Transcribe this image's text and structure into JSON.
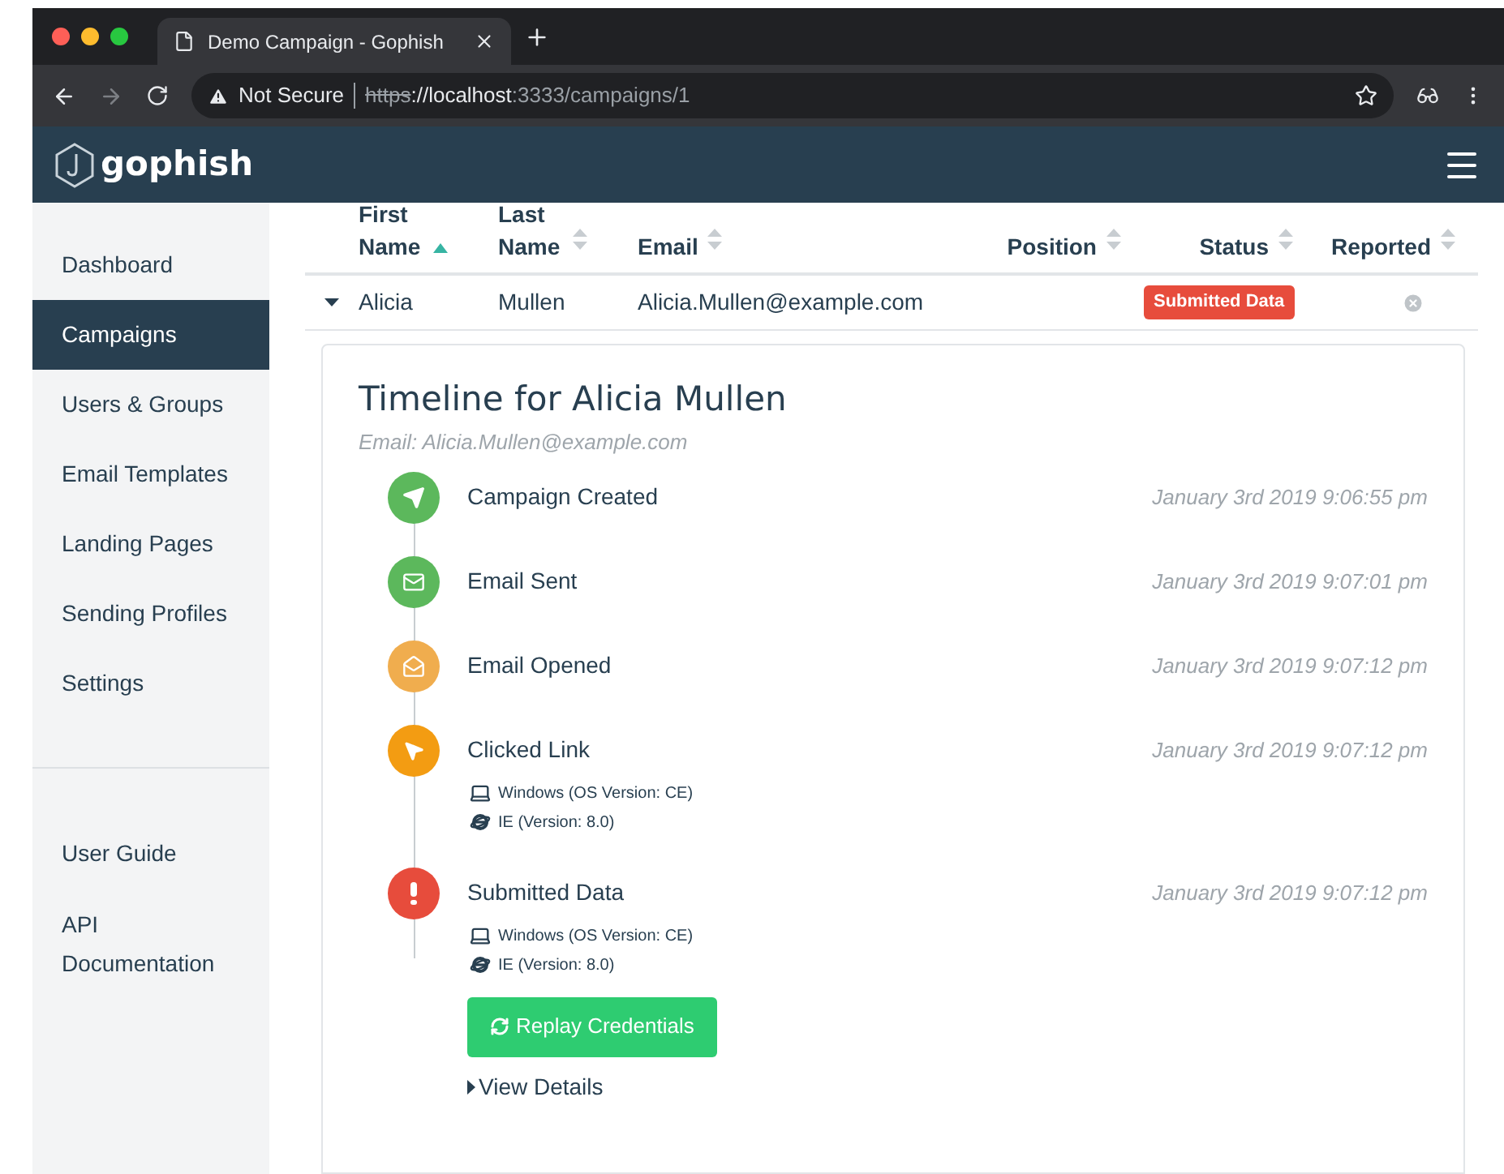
{
  "browser": {
    "tab_title": "Demo Campaign - Gophish",
    "security": "Not Secure",
    "url_scheme": "https",
    "url_host": "://localhost",
    "url_path": ":3333/campaigns/1"
  },
  "app": {
    "logo_text": "gophish"
  },
  "sidebar": {
    "items": [
      {
        "label": "Dashboard",
        "selected": false
      },
      {
        "label": "Campaigns",
        "selected": true
      },
      {
        "label": "Users & Groups",
        "selected": false
      },
      {
        "label": "Email Templates",
        "selected": false
      },
      {
        "label": "Landing Pages",
        "selected": false
      },
      {
        "label": "Sending Profiles",
        "selected": false
      },
      {
        "label": "Settings",
        "selected": false
      }
    ],
    "links": [
      "User Guide",
      "API Documentation"
    ]
  },
  "table": {
    "columns": [
      {
        "label": "First Name",
        "sorted": true
      },
      {
        "label": "Last Name",
        "sorted": false
      },
      {
        "label": "Email",
        "sorted": false
      },
      {
        "label": "Position",
        "sorted": false
      },
      {
        "label": "Status",
        "sorted": false
      },
      {
        "label": "Reported",
        "sorted": false
      }
    ],
    "rows": [
      {
        "expanded": true,
        "first_name": "Alicia",
        "last_name": "Mullen",
        "email": "Alicia.Mullen@example.com",
        "status": "Submitted Data",
        "reported": false
      }
    ]
  },
  "timeline": {
    "title": "Timeline for Alicia Mullen",
    "subtitle": "Email: Alicia.Mullen@example.com",
    "events": [
      {
        "kind": "created",
        "color": "#5cb85c",
        "label": "Campaign Created",
        "time": "January 3rd 2019 9:06:55 pm"
      },
      {
        "kind": "sent",
        "color": "#5cb85c",
        "label": "Email Sent",
        "time": "January 3rd 2019 9:07:01 pm"
      },
      {
        "kind": "opened",
        "color": "#f0ad4e",
        "label": "Email Opened",
        "time": "January 3rd 2019 9:07:12 pm"
      },
      {
        "kind": "clicked",
        "color": "#f39c12",
        "label": "Clicked Link",
        "time": "January 3rd 2019 9:07:12 pm",
        "details": [
          {
            "kind": "os",
            "text": "Windows (OS Version: CE)"
          },
          {
            "kind": "browser",
            "text": "IE (Version: 8.0)"
          }
        ]
      },
      {
        "kind": "submitted",
        "color": "#e74c3c",
        "label": "Submitted Data",
        "time": "January 3rd 2019 9:07:12 pm",
        "details": [
          {
            "kind": "os",
            "text": "Windows (OS Version: CE)"
          },
          {
            "kind": "browser",
            "text": "IE (Version: 8.0)"
          }
        ],
        "action": "Replay Credentials",
        "toggle": "View Details"
      }
    ]
  }
}
